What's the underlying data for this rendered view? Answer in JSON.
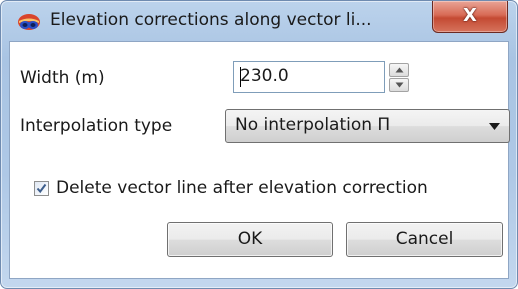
{
  "window": {
    "title": "Elevation corrections along vector li...",
    "close_glyph": "X"
  },
  "fields": {
    "width_label": "Width (m)",
    "width_value": "230.0",
    "interpolation_label": "Interpolation type",
    "interpolation_selected": "No interpolation П"
  },
  "options": {
    "delete_line_label": "Delete vector line after elevation correction",
    "delete_line_checked": true
  },
  "buttons": {
    "ok_label": "OK",
    "cancel_label": "Cancel"
  },
  "icons": {
    "app": "app-logo-icon",
    "close": "close-icon",
    "spin_up": "spin-up-icon",
    "spin_down": "spin-down-icon",
    "dropdown": "dropdown-arrow-icon",
    "check": "checkmark-icon"
  },
  "colors": {
    "title_bar": "#aec8e6",
    "close_button": "#c44a33",
    "client_bg": "#ffffff",
    "check_mark": "#3d5e8c"
  }
}
